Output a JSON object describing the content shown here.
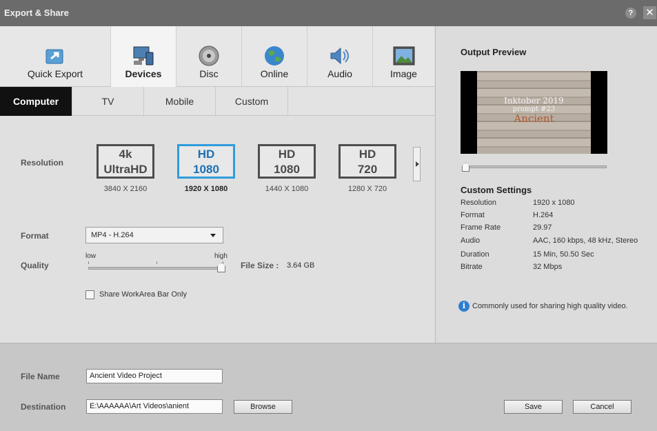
{
  "window": {
    "title": "Export & Share",
    "help": "?",
    "close": "✕"
  },
  "category_tabs": [
    {
      "label": "Quick Export",
      "icon": "quick-export-icon"
    },
    {
      "label": "Devices",
      "icon": "devices-icon",
      "active": true
    },
    {
      "label": "Disc",
      "icon": "disc-icon"
    },
    {
      "label": "Online",
      "icon": "globe-icon"
    },
    {
      "label": "Audio",
      "icon": "speaker-icon"
    },
    {
      "label": "Image",
      "icon": "image-icon"
    }
  ],
  "sub_tabs": [
    {
      "label": "Computer",
      "active": true
    },
    {
      "label": "TV"
    },
    {
      "label": "Mobile"
    },
    {
      "label": "Custom"
    }
  ],
  "resolution": {
    "label": "Resolution",
    "options": [
      {
        "line1": "4k",
        "line2": "UltraHD",
        "dims": "3840 X 2160"
      },
      {
        "line1": "HD",
        "line2": "1080",
        "dims": "1920 X 1080",
        "selected": true
      },
      {
        "line1": "HD",
        "line2": "1080",
        "dims": "1440 X 1080"
      },
      {
        "line1": "HD",
        "line2": "720",
        "dims": "1280 X 720"
      }
    ]
  },
  "format": {
    "label": "Format",
    "value": "MP4 - H.264"
  },
  "quality": {
    "label": "Quality",
    "low": "low",
    "high": "high",
    "level": 1.0
  },
  "file_size": {
    "label": "File Size :",
    "value": "3.64 GB"
  },
  "workarea": {
    "label": "Share WorkArea Bar Only",
    "checked": false
  },
  "bottom": {
    "file_name_label": "File Name",
    "file_name_value": "Ancient Video Project",
    "destination_label": "Destination",
    "destination_value": "E:\\AAAAAA\\Art Videos\\anient",
    "browse": "Browse",
    "save": "Save",
    "cancel": "Cancel"
  },
  "preview": {
    "title": "Output Preview",
    "line1": "Inktober 2019",
    "line2": "prompt #23",
    "line3": "Ancient",
    "position": 0.0
  },
  "custom_settings": {
    "title": "Custom Settings",
    "rows": [
      {
        "key": "Resolution",
        "value": "1920 x 1080"
      },
      {
        "key": "Format",
        "value": "H.264"
      },
      {
        "key": "Frame Rate",
        "value": "29.97"
      },
      {
        "key": "Audio",
        "value": "AAC, 160 kbps, 48 kHz, Stereo"
      },
      {
        "key": "Duration",
        "value": "15 Min, 50.50 Sec"
      },
      {
        "key": "Bitrate",
        "value": "32 Mbps"
      }
    ],
    "info": "Commonly used for sharing high quality video."
  },
  "colors": {
    "accent": "#2f9bdc",
    "title_bar": "#6b6b6b",
    "active_sub_tab": "#111111"
  }
}
